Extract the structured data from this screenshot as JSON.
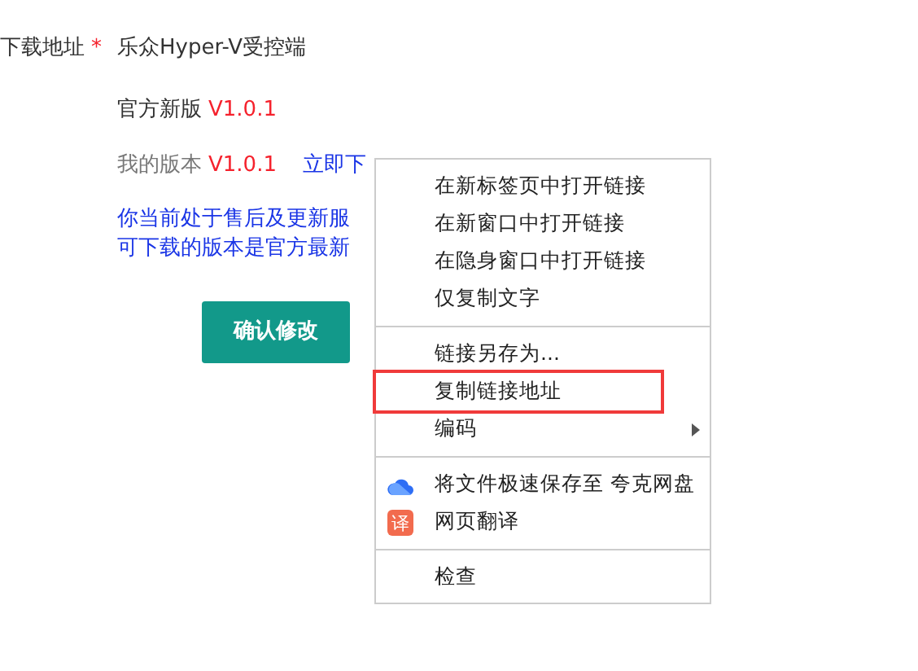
{
  "form": {
    "label": "下载地址",
    "required_mark": "*",
    "product": "乐众Hyper-V受控端",
    "official_label": "官方新版",
    "official_version": "V1.0.1",
    "my_label": "我的版本",
    "my_version": "V1.0.1",
    "download_link": "立即下",
    "notice_lines": [
      "你当前处于售后及更新服",
      "可下载的版本是官方最新"
    ],
    "submit": "确认修改"
  },
  "context_menu": {
    "groups": [
      [
        {
          "label": "在新标签页中打开链接",
          "highlighted": false,
          "submenu": false
        },
        {
          "label": "在新窗口中打开链接",
          "highlighted": false,
          "submenu": false
        },
        {
          "label": "在隐身窗口中打开链接",
          "highlighted": false,
          "submenu": false
        },
        {
          "label": "仅复制文字",
          "highlighted": false,
          "submenu": false
        }
      ],
      [
        {
          "label": "链接另存为...",
          "highlighted": false,
          "submenu": false
        },
        {
          "label": "复制链接地址",
          "highlighted": true,
          "submenu": false
        },
        {
          "label": "编码",
          "highlighted": false,
          "submenu": true
        }
      ],
      [
        {
          "label": "将文件极速保存至 夸克网盘",
          "highlighted": false,
          "submenu": false,
          "kind": "cloud"
        },
        {
          "label": "网页翻译",
          "highlighted": false,
          "submenu": false,
          "kind": "badge",
          "icon_text": "译"
        }
      ],
      [
        {
          "label": "检查",
          "highlighted": false,
          "submenu": false
        }
      ]
    ]
  }
}
